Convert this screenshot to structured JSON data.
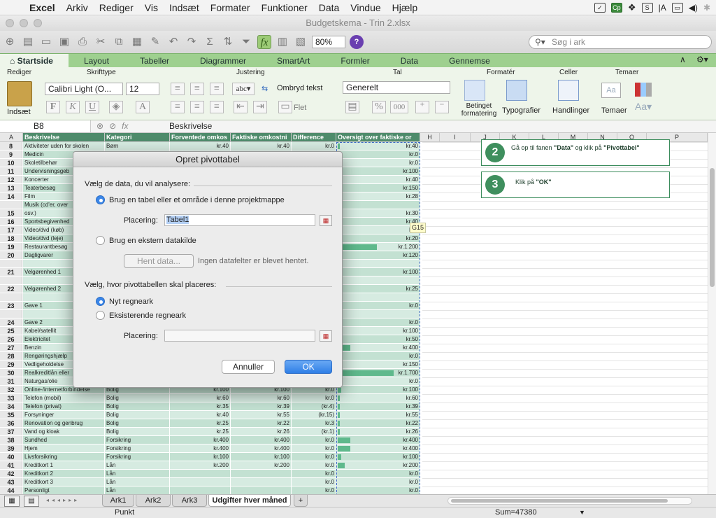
{
  "menubar": {
    "app": "Excel",
    "items": [
      "Arkiv",
      "Rediger",
      "Vis",
      "Indsæt",
      "Formater",
      "Funktioner",
      "Data",
      "Vindue"
    ],
    "help": "Hjælp"
  },
  "window": {
    "title": "Budgetskema - Trin 2.xlsx"
  },
  "toolbar": {
    "zoom": "80%",
    "search_placeholder": "Søg i ark"
  },
  "ribbon": {
    "tabs": [
      "Startside",
      "Layout",
      "Tabeller",
      "Diagrammer",
      "SmartArt",
      "Formler",
      "Data",
      "Gennemse"
    ],
    "groups": {
      "edit": "Rediger",
      "font": "Skrifttype",
      "align": "Justering",
      "number": "Tal",
      "format": "Formatér",
      "cells": "Celler",
      "themes": "Temaer"
    },
    "insert_label": "Indsæt",
    "font_name": "Calibri Light (O...",
    "font_size": "12",
    "wrap_label": "Ombryd tekst",
    "merge_label": "Flet",
    "number_format": "Generelt",
    "cond_format": "Betinget formatering",
    "styles": "Typografier",
    "cells_btn": "Handlinger",
    "themes_btn": "Temaer"
  },
  "formula_bar": {
    "cell_ref": "B8",
    "content": "Beskrivelse"
  },
  "columns": [
    "A",
    "Beskrivelse",
    "Kategori",
    "Forventede omkos",
    "Faktiske omkostni",
    "Difference",
    "Oversigt over faktiske or",
    "H",
    "I",
    "J",
    "K",
    "L",
    "M",
    "N",
    "O",
    "P"
  ],
  "rows": [
    {
      "n": "8",
      "b": "Aktiviteter uden for skolen",
      "c": "Børn",
      "d": "kr.40",
      "e": "kr.40",
      "f": "kr.0",
      "g": "kr.40",
      "bar": 0.02
    },
    {
      "n": "9",
      "b": "Medicin",
      "c": "",
      "d": "",
      "e": "",
      "f": "",
      "g": "kr.0",
      "bar": 0
    },
    {
      "n": "10",
      "b": "Skoletilbehør",
      "c": "",
      "d": "",
      "e": "",
      "f": "",
      "g": "kr.0",
      "bar": 0
    },
    {
      "n": "11",
      "b": "Undervisningsgeb",
      "c": "",
      "d": "",
      "e": "",
      "f": "",
      "g": "kr.100",
      "bar": 0
    },
    {
      "n": "12",
      "b": "Koncerter",
      "c": "",
      "d": "",
      "e": "",
      "f": "",
      "g": "kr.40",
      "bar": 0
    },
    {
      "n": "13",
      "b": "Teaterbesøg",
      "c": "",
      "d": "",
      "e": "",
      "f": "",
      "g": "kr.150",
      "bar": 0.09
    },
    {
      "n": "14",
      "b": "Film",
      "c": "",
      "d": "",
      "e": "",
      "f": "",
      "g": "kr.28",
      "bar": 0
    },
    {
      "n": "15a",
      "b": "Musik (cd'er, over",
      "c": "",
      "d": "",
      "e": "",
      "f": "",
      "g": "",
      "bar": 0
    },
    {
      "n": "15",
      "b": "osv.)",
      "c": "",
      "d": "",
      "e": "",
      "f": "",
      "g": "kr.30",
      "bar": 0
    },
    {
      "n": "16",
      "b": "Sportsbegivenhed",
      "c": "",
      "d": "",
      "e": "",
      "f": "",
      "g": "kr.40",
      "bar": 0
    },
    {
      "n": "17",
      "b": "Video/dvd (køb)",
      "c": "",
      "d": "",
      "e": "",
      "f": "",
      "g": "kr.0",
      "bar": 0
    },
    {
      "n": "18",
      "b": "Video/dvd (leje)",
      "c": "",
      "d": "",
      "e": "",
      "f": "",
      "g": "kr.20",
      "bar": 0
    },
    {
      "n": "19",
      "b": "Restaurantbesøg",
      "c": "",
      "d": "",
      "e": "",
      "f": "",
      "g": "kr.1.200",
      "bar": 0.7
    },
    {
      "n": "20",
      "b": "Dagligvarer",
      "c": "",
      "d": "",
      "e": "",
      "f": "",
      "g": "kr.120",
      "bar": 0.07
    },
    {
      "n": "",
      "b": "",
      "c": "",
      "d": "",
      "e": "",
      "f": "",
      "g": "",
      "bar": 0
    },
    {
      "n": "21",
      "b": "Velgørenhed 1",
      "c": "",
      "d": "",
      "e": "",
      "f": "",
      "g": "kr.100",
      "bar": 0
    },
    {
      "n": "",
      "b": "",
      "c": "",
      "d": "",
      "e": "",
      "f": "",
      "g": "",
      "bar": 0
    },
    {
      "n": "22",
      "b": "Velgørenhed 2",
      "c": "",
      "d": "",
      "e": "",
      "f": "",
      "g": "kr.25",
      "bar": 0
    },
    {
      "n": "",
      "b": "",
      "c": "",
      "d": "",
      "e": "",
      "f": "",
      "g": "",
      "bar": 0
    },
    {
      "n": "23",
      "b": "Gave 1",
      "c": "",
      "d": "",
      "e": "",
      "f": "",
      "g": "kr.0",
      "bar": 0
    },
    {
      "n": "",
      "b": "",
      "c": "",
      "d": "",
      "e": "",
      "f": "",
      "g": "",
      "bar": 0
    },
    {
      "n": "24",
      "b": "Gave 2",
      "c": "",
      "d": "",
      "e": "",
      "f": "",
      "g": "kr.0",
      "bar": 0
    },
    {
      "n": "25",
      "b": "Kabel/satellit",
      "c": "",
      "d": "",
      "e": "",
      "f": "",
      "g": "kr.100",
      "bar": 0
    },
    {
      "n": "26",
      "b": "Elektricitet",
      "c": "",
      "d": "",
      "e": "",
      "f": "",
      "g": "kr.50",
      "bar": 0
    },
    {
      "n": "27",
      "b": "Benzin",
      "c": "",
      "d": "",
      "e": "",
      "f": "",
      "g": "kr.400",
      "bar": 0.23
    },
    {
      "n": "28",
      "b": "Rengøringshjælp",
      "c": "",
      "d": "",
      "e": "",
      "f": "",
      "g": "kr.0",
      "bar": 0
    },
    {
      "n": "29",
      "b": "Vedligeholdelse",
      "c": "",
      "d": "",
      "e": "",
      "f": "",
      "g": "kr.150",
      "bar": 0.09
    },
    {
      "n": "30",
      "b": "Realkreditlån eller",
      "c": "",
      "d": "",
      "e": "",
      "f": "",
      "g": "kr.1.700",
      "bar": 1
    },
    {
      "n": "31",
      "b": "Naturgas/olie",
      "c": "",
      "d": "",
      "e": "",
      "f": "",
      "g": "kr.0",
      "bar": 0
    },
    {
      "n": "32",
      "b": "Online-/internetforbindelse",
      "c": "Bolig",
      "d": "kr.100",
      "e": "kr.100",
      "f": "kr.0",
      "g": "kr.100",
      "bar": 0.06
    },
    {
      "n": "33",
      "b": "Telefon (mobil)",
      "c": "Bolig",
      "d": "kr.60",
      "e": "kr.60",
      "f": "kr.0",
      "g": "kr.60",
      "bar": 0.04
    },
    {
      "n": "34",
      "b": "Telefon (privat)",
      "c": "Bolig",
      "d": "kr.35",
      "e": "kr.39",
      "f": "(kr.4)",
      "g": "kr.39",
      "bar": 0.03
    },
    {
      "n": "35",
      "b": "Forsyninger",
      "c": "Bolig",
      "d": "kr.40",
      "e": "kr.55",
      "f": "(kr.15)",
      "g": "kr.55",
      "bar": 0.03
    },
    {
      "n": "36",
      "b": "Renovation og genbrug",
      "c": "Bolig",
      "d": "kr.25",
      "e": "kr.22",
      "f": "kr.3",
      "g": "kr.22",
      "bar": 0.01
    },
    {
      "n": "37",
      "b": "Vand og kloak",
      "c": "Bolig",
      "d": "kr.25",
      "e": "kr.26",
      "f": "(kr.1)",
      "g": "kr.26",
      "bar": 0.02
    },
    {
      "n": "38",
      "b": "Sundhed",
      "c": "Forsikring",
      "d": "kr.400",
      "e": "kr.400",
      "f": "kr.0",
      "g": "kr.400",
      "bar": 0.23
    },
    {
      "n": "39",
      "b": "Hjem",
      "c": "Forsikring",
      "d": "kr.400",
      "e": "kr.400",
      "f": "kr.0",
      "g": "kr.400",
      "bar": 0.23
    },
    {
      "n": "40",
      "b": "Livsforsikring",
      "c": "Forsikring",
      "d": "kr.100",
      "e": "kr.100",
      "f": "kr.0",
      "g": "kr.100",
      "bar": 0.06
    },
    {
      "n": "41",
      "b": "Kreditkort 1",
      "c": "Lån",
      "d": "kr.200",
      "e": "kr.200",
      "f": "kr.0",
      "g": "kr.200",
      "bar": 0.12
    },
    {
      "n": "42",
      "b": "Kreditkort 2",
      "c": "Lån",
      "d": "",
      "e": "",
      "f": "kr.0",
      "g": "kr.0",
      "bar": 0
    },
    {
      "n": "43",
      "b": "Kreditkort 3",
      "c": "Lån",
      "d": "",
      "e": "",
      "f": "kr.0",
      "g": "kr.0",
      "bar": 0
    },
    {
      "n": "44",
      "b": "Personligt",
      "c": "Lån",
      "d": "",
      "e": "",
      "f": "kr.0",
      "g": "kr.0",
      "bar": 0
    }
  ],
  "steps": [
    {
      "num": "2",
      "text_pre": "Gå op til fanen ",
      "b1": "\"Data\"",
      "mid": " og klik på ",
      "b2": "\"Pivottabel\""
    },
    {
      "num": "3",
      "text_pre": "Klik på ",
      "b1": "\"OK\"",
      "mid": "",
      "b2": ""
    }
  ],
  "tooltip": "G15",
  "dialog": {
    "title": "Opret pivottabel",
    "section1": "Vælg de data, du vil analysere:",
    "opt_table": "Brug en tabel eller et område i denne projektmappe",
    "placering_label": "Placering:",
    "placering_value": "Tabel1",
    "opt_external": "Brug en ekstern datakilde",
    "get_data": "Hent data...",
    "no_fields": "Ingen datafelter er blevet hentet.",
    "section2": "Vælg, hvor pivottabellen skal placeres:",
    "opt_new": "Nyt regneark",
    "opt_existing": "Eksisterende regneark",
    "placering2_label": "Placering:",
    "placering2_value": "",
    "cancel": "Annuller",
    "ok": "OK"
  },
  "sheets": [
    "Ark1",
    "Ark2",
    "Ark3",
    "Udgifter hver måned"
  ],
  "status": {
    "mode": "Punkt",
    "sum": "Sum=47380"
  }
}
